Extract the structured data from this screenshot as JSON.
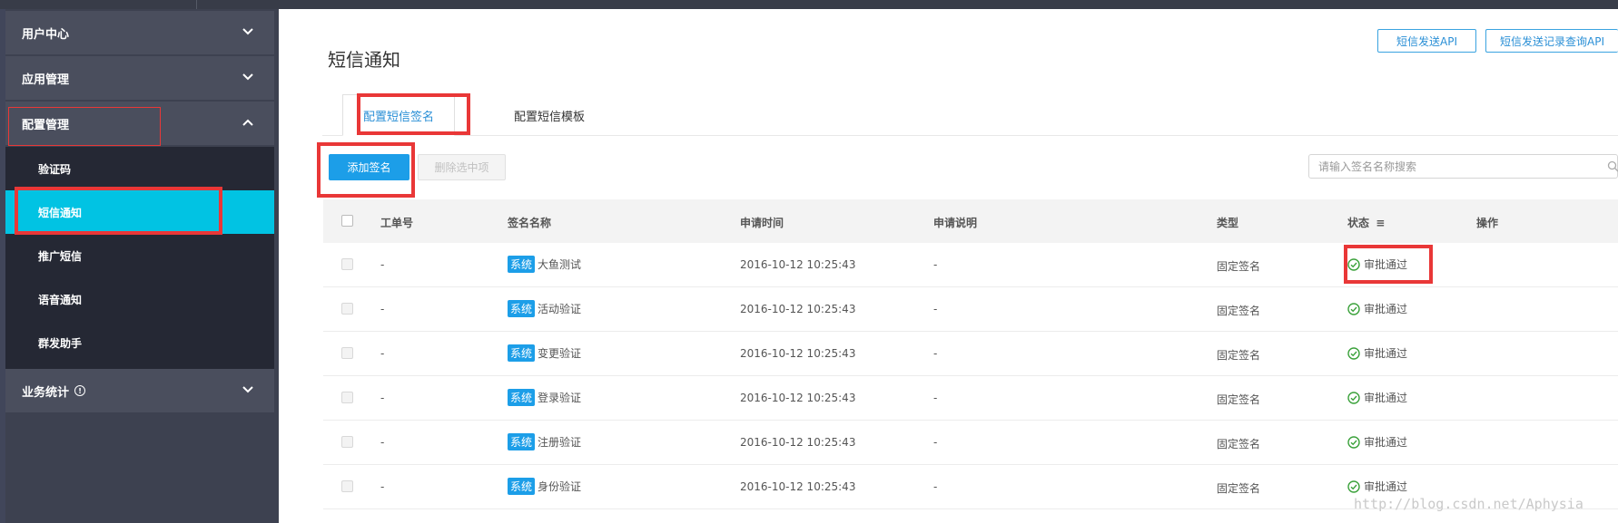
{
  "sidebar": {
    "groups": [
      {
        "label": "用户中心"
      },
      {
        "label": "应用管理"
      },
      {
        "label": "配置管理"
      },
      {
        "label": "业务统计"
      }
    ],
    "sub_items": [
      {
        "label": "验证码"
      },
      {
        "label": "短信通知"
      },
      {
        "label": "推广短信"
      },
      {
        "label": "语音通知"
      },
      {
        "label": "群发助手"
      }
    ],
    "info_glyph": "!"
  },
  "header": {
    "title": "短信通知",
    "api_buttons": [
      "短信发送API",
      "短信发送记录查询API"
    ]
  },
  "tabs": [
    {
      "label": "配置短信签名"
    },
    {
      "label": "配置短信模板"
    }
  ],
  "toolbar": {
    "add_label": "添加签名",
    "delete_label": "删除选中项"
  },
  "search": {
    "placeholder": "请输入签名名称搜索"
  },
  "table": {
    "columns": [
      "工单号",
      "签名名称",
      "申请时间",
      "申请说明",
      "类型",
      "状态",
      "操作"
    ],
    "status_filter_glyph": "≡",
    "rows": [
      {
        "id": "-",
        "badge": "系统",
        "name": "大鱼测试",
        "time": "2016-10-12 10:25:43",
        "note": "-",
        "type": "固定签名",
        "status": "审批通过"
      },
      {
        "id": "-",
        "badge": "系统",
        "name": "活动验证",
        "time": "2016-10-12 10:25:43",
        "note": "-",
        "type": "固定签名",
        "status": "审批通过"
      },
      {
        "id": "-",
        "badge": "系统",
        "name": "变更验证",
        "time": "2016-10-12 10:25:43",
        "note": "-",
        "type": "固定签名",
        "status": "审批通过"
      },
      {
        "id": "-",
        "badge": "系统",
        "name": "登录验证",
        "time": "2016-10-12 10:25:43",
        "note": "-",
        "type": "固定签名",
        "status": "审批通过"
      },
      {
        "id": "-",
        "badge": "系统",
        "name": "注册验证",
        "time": "2016-10-12 10:25:43",
        "note": "-",
        "type": "固定签名",
        "status": "审批通过"
      },
      {
        "id": "-",
        "badge": "系统",
        "name": "身份验证",
        "time": "2016-10-12 10:25:43",
        "note": "-",
        "type": "固定签名",
        "status": "审批通过"
      }
    ]
  },
  "watermark": "http://blog.csdn.net/Aphysia",
  "colors": {
    "accent": "#1c9ee8",
    "sidebar_active": "#01c3e3",
    "highlight": "#e93737",
    "success": "#3aa13a"
  }
}
